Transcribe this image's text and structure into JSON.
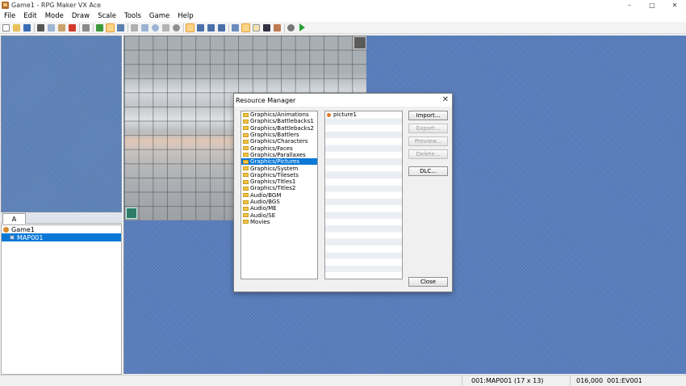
{
  "window": {
    "title": "Game1 - RPG Maker VX Ace",
    "minimize": "–",
    "maximize": "□",
    "close": "✕"
  },
  "menu": [
    "File",
    "Edit",
    "Mode",
    "Draw",
    "Scale",
    "Tools",
    "Game",
    "Help"
  ],
  "toolbar": {
    "icons": [
      "new-project",
      "open-project",
      "save-project",
      "cut",
      "copy",
      "paste",
      "delete",
      "undo",
      "layer-map",
      "layer-event",
      "region",
      "pencil",
      "rectangle",
      "ellipse",
      "flood-fill",
      "shadow-pen",
      "scale-1-1",
      "scale-1-2",
      "scale-1-4",
      "scale-1-8",
      "database",
      "resource-manager",
      "script-editor",
      "sound-test",
      "character-generator",
      "options",
      "playtest"
    ],
    "active": [
      "layer-event",
      "resource-manager",
      "scale-1-1"
    ]
  },
  "palette": {
    "tab": "A"
  },
  "maptree": {
    "project": "Game1",
    "maps": [
      "MAP001"
    ]
  },
  "status": {
    "map": "001:MAP001 (17 x 13)",
    "coords": "016,000",
    "event": "001:EV001"
  },
  "dialog": {
    "title": "Resource Manager",
    "close": "✕",
    "folders": [
      "Graphics/Animations",
      "Graphics/Battlebacks1",
      "Graphics/Battlebacks2",
      "Graphics/Battlers",
      "Graphics/Characters",
      "Graphics/Faces",
      "Graphics/Parallaxes",
      "Graphics/Pictures",
      "Graphics/System",
      "Graphics/Tilesets",
      "Graphics/Titles1",
      "Graphics/Titles2",
      "Audio/BGM",
      "Audio/BGS",
      "Audio/ME",
      "Audio/SE",
      "Movies"
    ],
    "selected_folder": "Graphics/Pictures",
    "files": [
      "picture1"
    ],
    "buttons": {
      "import": "Import...",
      "export": "Export...",
      "preview": "Preview...",
      "delete": "Delete...",
      "dlc": "DLC...",
      "close": "Close"
    }
  },
  "colors": {
    "selection": "#0a78d7",
    "map_bg": "#587dbd",
    "folder": "#f3c447"
  }
}
